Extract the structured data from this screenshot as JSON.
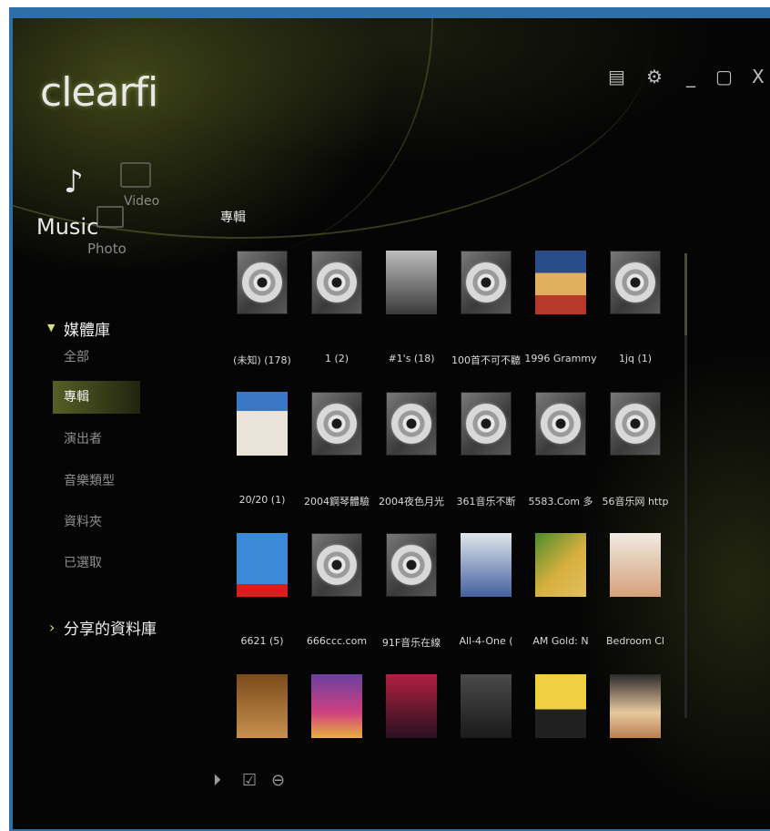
{
  "app": {
    "logo_text": "clearfi"
  },
  "media_switch": {
    "music": "Music",
    "video": "Video",
    "photo": "Photo"
  },
  "sidebar": {
    "library_header": "媒體庫",
    "items": [
      {
        "label": "全部"
      },
      {
        "label": "專輯"
      },
      {
        "label": "演出者"
      },
      {
        "label": "音樂類型"
      },
      {
        "label": "資料夾"
      },
      {
        "label": "已選取"
      }
    ],
    "selected_index": 1,
    "shared_header": "分享的資料庫"
  },
  "content": {
    "section_title": "專輯",
    "albums": [
      {
        "caption": "(未知) (178)",
        "art": "cd"
      },
      {
        "caption": "1 (2)",
        "art": "cd"
      },
      {
        "caption": "#1's (18)",
        "art": "bw"
      },
      {
        "caption": "100首不可不聽",
        "art": "cd"
      },
      {
        "caption": "1996 Grammy",
        "art": "poster"
      },
      {
        "caption": "1jq (1)",
        "art": "cd"
      },
      {
        "caption": "20/20 (1)",
        "art": "portrait"
      },
      {
        "caption": "2004鋼琴體驗",
        "art": "cd"
      },
      {
        "caption": "2004夜色月光",
        "art": "cd"
      },
      {
        "caption": "361音乐不断",
        "art": "cd"
      },
      {
        "caption": "5583.Com 多",
        "art": "cd"
      },
      {
        "caption": "56音乐网 http",
        "art": "cd"
      },
      {
        "caption": "6621 (5)",
        "art": "logo"
      },
      {
        "caption": "666ccc.com",
        "art": "cd"
      },
      {
        "caption": "91F音乐在線",
        "art": "cd"
      },
      {
        "caption": "All-4-One (",
        "art": "group"
      },
      {
        "caption": "AM Gold: N",
        "art": "gold"
      },
      {
        "caption": "Bedroom Cl",
        "art": "bedroom"
      },
      {
        "caption": "",
        "art": "sepia"
      },
      {
        "caption": "",
        "art": "colorful"
      },
      {
        "caption": "",
        "art": "red"
      },
      {
        "caption": "",
        "art": "band"
      },
      {
        "caption": "",
        "art": "city"
      },
      {
        "caption": "",
        "art": "blonde"
      }
    ]
  },
  "window_controls": [
    "device-icon",
    "gear-icon",
    "minimize-icon",
    "maximize-icon",
    "close-icon"
  ],
  "colors": {
    "accent": "#d8df7a",
    "selection": "#5f6928",
    "background": "#050505"
  }
}
